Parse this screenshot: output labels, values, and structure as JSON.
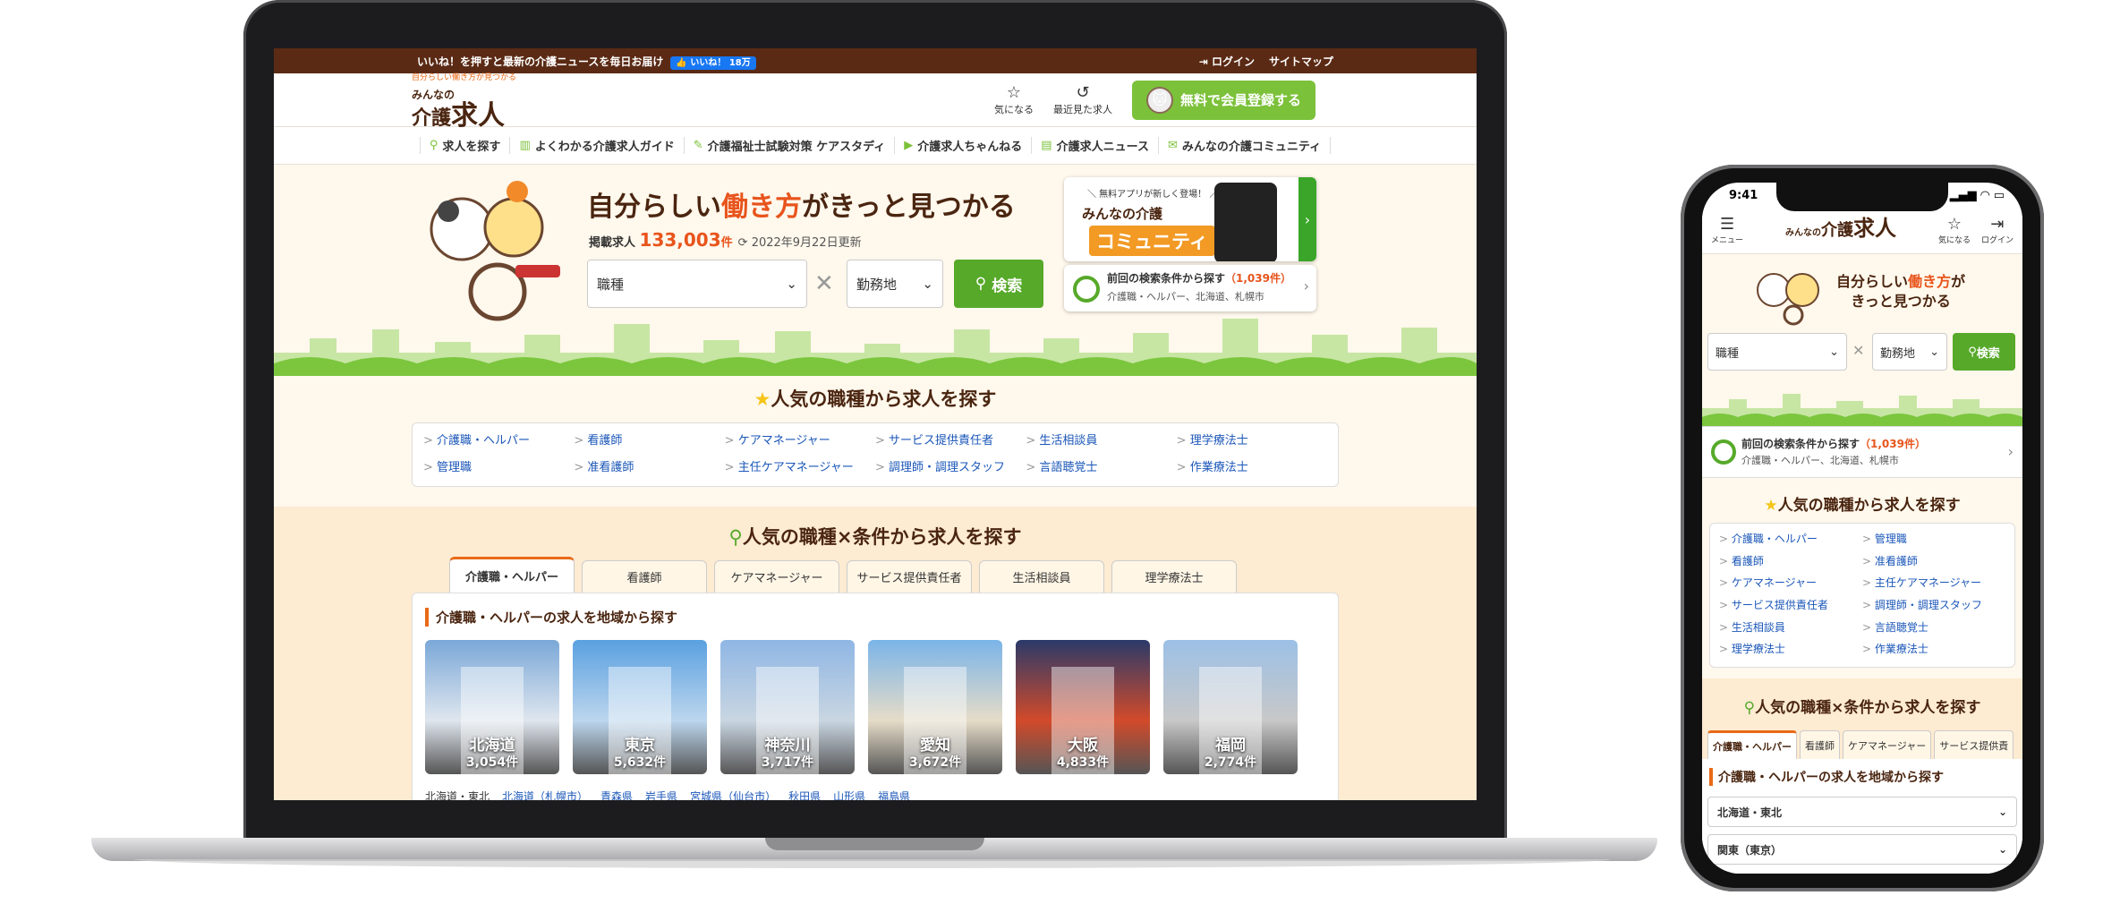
{
  "topbar": {
    "message": "いいね！を押すと最新の介護ニュースを毎日お届け",
    "like_label": "👍 いいね！ 18万",
    "login": "ログイン",
    "sitemap": "サイトマップ"
  },
  "logo": {
    "tagline": "自分らしい働き方が見つかる",
    "line1": "みんなの",
    "line2": "介護",
    "line3": "求人"
  },
  "header": {
    "favorite": "気になる",
    "recent": "最近見た求人",
    "register": "無料で会員登録する"
  },
  "gnav": [
    {
      "label": "求人を探す",
      "icon": "search-icon",
      "glyph": "⚲"
    },
    {
      "label": "よくわかる介護求人ガイド",
      "icon": "book-icon",
      "glyph": "▥"
    },
    {
      "label": "介護福祉士試験対策 ケアスタディ",
      "icon": "pencil-icon",
      "glyph": "✎"
    },
    {
      "label": "介護求人ちゃんねる",
      "icon": "youtube-icon",
      "glyph": "▶"
    },
    {
      "label": "介護求人ニュース",
      "icon": "news-icon",
      "glyph": "▤"
    },
    {
      "label": "みんなの介護コミュニティ",
      "icon": "chat-icon",
      "glyph": "✉"
    }
  ],
  "hero": {
    "title_pre": "自分らしい",
    "title_em": "働き方",
    "title_post": "がきっと見つかる",
    "count_label": "掲載求人",
    "count_value": "133,003",
    "count_unit": "件",
    "updated": "2022年9月22日更新",
    "job_select": "職種",
    "area_select": "勤務地",
    "search_button": "検索",
    "promo_small": "＼ 無料アプリが新しく登場！ ／",
    "promo_line1": "みんなの介護",
    "promo_line2": "コミュニティ",
    "recent_title": "前回の検索条件から探す",
    "recent_count": "（1,039件）",
    "recent_sub": "介護職・ヘルパー、北海道、札幌市"
  },
  "popular": {
    "title": "人気の職種から求人を探す",
    "items": [
      "介護職・ヘルパー",
      "看護師",
      "ケアマネージャー",
      "サービス提供責任者",
      "生活相談員",
      "理学療法士",
      "管理職",
      "准看護師",
      "主任ケアマネージャー",
      "調理師・調理スタッフ",
      "言語聴覚士",
      "作業療法士"
    ]
  },
  "conditions": {
    "title": "人気の職種×条件から求人を探す",
    "tabs": [
      "介護職・ヘルパー",
      "看護師",
      "ケアマネージャー",
      "サービス提供責任者",
      "生活相談員",
      "理学療法士"
    ],
    "panel_title": "介護職・ヘルパーの求人を地域から探す",
    "areas": [
      {
        "name": "北海道",
        "count": "3,054件"
      },
      {
        "name": "東京",
        "count": "5,632件"
      },
      {
        "name": "神奈川",
        "count": "3,717件"
      },
      {
        "name": "愛知",
        "count": "3,672件"
      },
      {
        "name": "大阪",
        "count": "4,833件"
      },
      {
        "name": "福岡",
        "count": "2,774件"
      }
    ],
    "region_label": "北海道・東北",
    "region_links": [
      "北海道（札幌市）",
      "青森県",
      "岩手県",
      "宮城県（仙台市）",
      "秋田県",
      "山形県",
      "福島県"
    ]
  },
  "phone": {
    "time": "9:41",
    "menu": "メニュー",
    "favorite": "気になる",
    "login": "ログイン",
    "hero_line1_pre": "自分らしい",
    "hero_line1_em": "働き方",
    "hero_line1_post": "が",
    "hero_line2": "きっと見つかる",
    "job_select": "職種",
    "area_select": "勤務地",
    "search_button": "検索",
    "recent_title": "前回の検索条件から探す",
    "recent_count": "（1,039件）",
    "recent_sub": "介護職・ヘルパー、北海道、札幌市",
    "popular_title": "人気の職種から求人を探す",
    "popular_items": [
      "介護職・ヘルパー",
      "管理職",
      "看護師",
      "准看護師",
      "ケアマネージャー",
      "主任ケアマネージャー",
      "サービス提供責任者",
      "調理師・調理スタッフ",
      "生活相談員",
      "言語聴覚士",
      "理学療法士",
      "作業療法士"
    ],
    "cond_title": "人気の職種×条件から求人を探す",
    "tabs": [
      "介護職・ヘルパー",
      "看護師",
      "ケアマネージャー",
      "サービス提供責"
    ],
    "panel_title": "介護職・ヘルパーの求人を地域から探す",
    "accordion1": "北海道・東北",
    "accordion2": "関東（東京）"
  },
  "colors": {
    "brand_brown": "#5a2a14",
    "accent_orange": "#e8541c",
    "green": "#57a92a",
    "link_blue": "#1a56b8"
  }
}
